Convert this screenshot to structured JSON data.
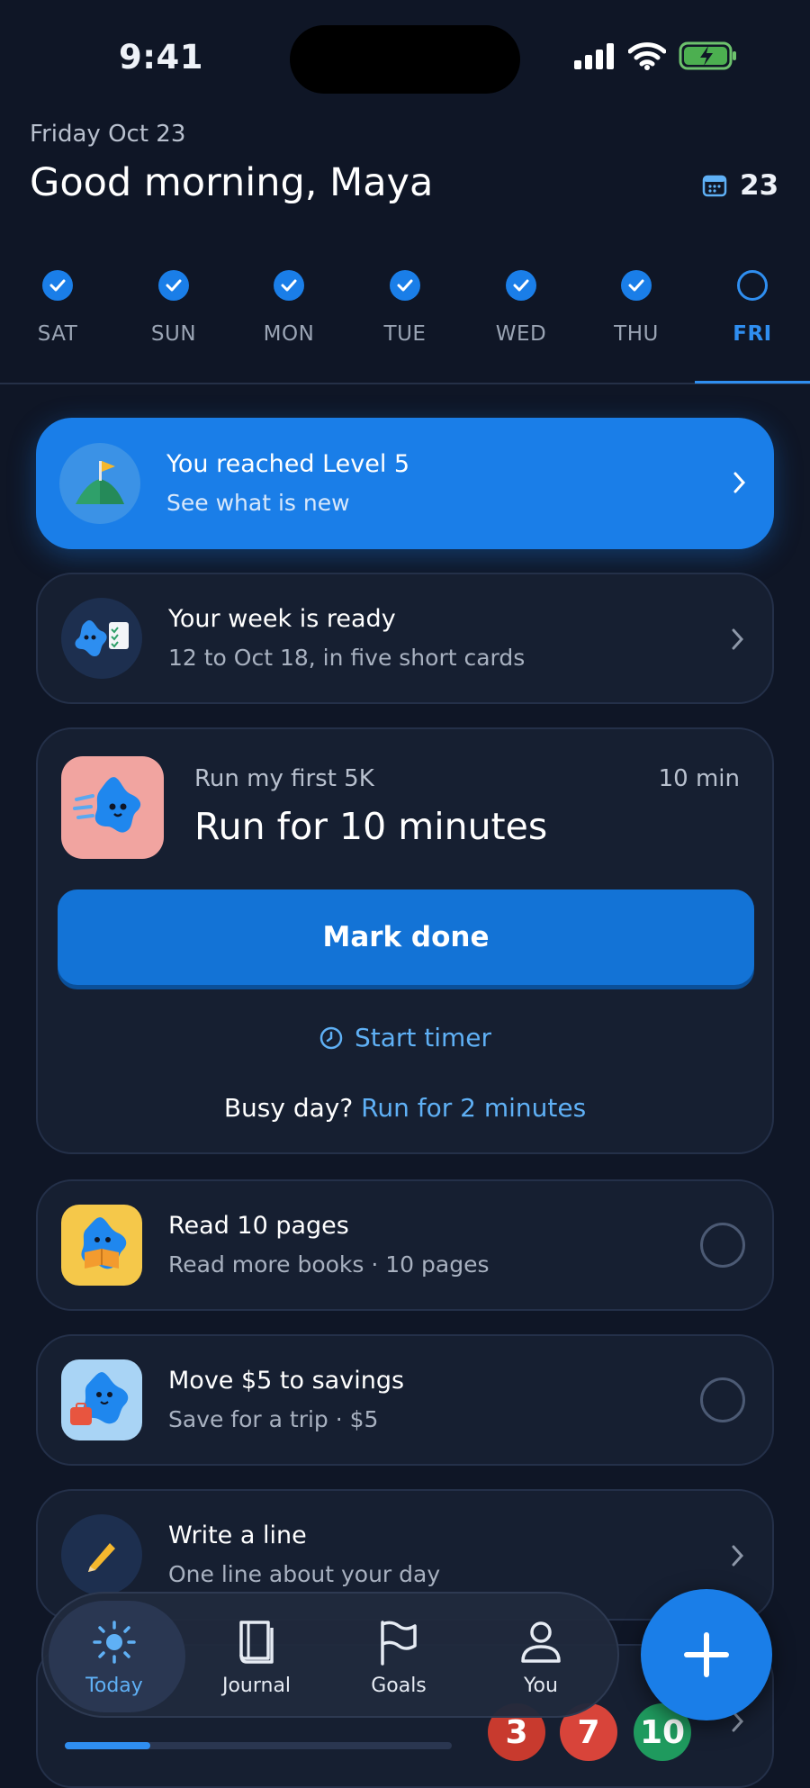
{
  "status": {
    "time": "9:41"
  },
  "header": {
    "date": "Friday Oct 23",
    "greeting": "Good morning, Maya",
    "calendar_day": "23"
  },
  "week": {
    "days": [
      {
        "label": "SAT",
        "done": true
      },
      {
        "label": "SUN",
        "done": true
      },
      {
        "label": "MON",
        "done": true
      },
      {
        "label": "TUE",
        "done": true
      },
      {
        "label": "WED",
        "done": true
      },
      {
        "label": "THU",
        "done": true
      },
      {
        "label": "FRI",
        "done": false,
        "active": true
      }
    ]
  },
  "cards": {
    "level": {
      "title": "You reached Level 5",
      "subtitle": "See what is new"
    },
    "week_ready": {
      "title": "Your week is ready",
      "subtitle": "12 to Oct 18, in five short cards"
    },
    "run": {
      "goal": "Run my first 5K",
      "duration": "10 min",
      "task": "Run for 10 minutes",
      "primary_button": "Mark done",
      "timer_label": "Start timer",
      "busy_prefix": "Busy day?",
      "busy_link": "Run for 2 minutes"
    },
    "read": {
      "title": "Read 10 pages",
      "subtitle": "Read more books · 10 pages"
    },
    "savings": {
      "title": "Move $5 to savings",
      "subtitle": "Save for a trip · $5"
    },
    "write": {
      "title": "Write a line",
      "subtitle": "One line about your day"
    },
    "peek": {
      "progress": 0.22,
      "badges": [
        "3",
        "7",
        "10"
      ]
    }
  },
  "nav": {
    "items": [
      {
        "label": "Today",
        "icon": "sun-icon",
        "active": true
      },
      {
        "label": "Journal",
        "icon": "book-icon"
      },
      {
        "label": "Goals",
        "icon": "flag-icon"
      },
      {
        "label": "You",
        "icon": "person-icon"
      }
    ],
    "fab_icon": "plus-icon"
  },
  "colors": {
    "accent": "#1a7ee8",
    "background": "#0f1626",
    "card": "#161f31"
  }
}
